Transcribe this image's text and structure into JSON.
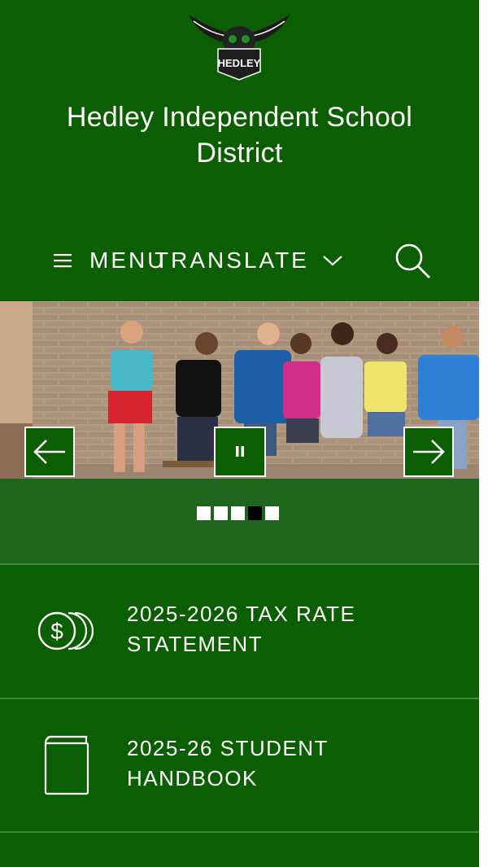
{
  "header": {
    "title_line1": "Hedley Independent School",
    "title_line2": "District",
    "logo_icon": "owl-mascot-logo-icon",
    "logo_text": "HEDLEY"
  },
  "nav": {
    "menu_label": "MENU",
    "translate_label": "TRANSLATE",
    "menu_icon": "hamburger-icon",
    "translate_icon": "chevron-down-icon",
    "search_icon": "search-icon"
  },
  "carousel": {
    "prev_icon": "arrow-left-icon",
    "pause_icon": "pause-icon",
    "next_icon": "arrow-right-icon",
    "slide_count": 5,
    "active_slide": 4
  },
  "quick_links": [
    {
      "label_line1": "2025-2026 TAX RATE",
      "label_line2": "STATEMENT",
      "icon": "coins-icon"
    },
    {
      "label_line1": "2025-26 STUDENT",
      "label_line2": "HANDBOOK",
      "icon": "book-icon"
    }
  ],
  "colors": {
    "brand_green": "#0b5f02",
    "band_green": "#1e661b",
    "divider": "#3e8a3a",
    "text": "#ffffff"
  }
}
